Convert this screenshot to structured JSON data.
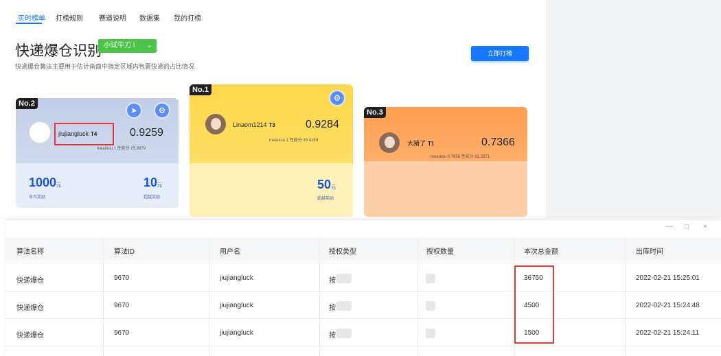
{
  "nav": {
    "tabs": [
      "实时榜单",
      "打榜规则",
      "赛道说明",
      "数据集",
      "我的打榜"
    ],
    "active_index": 0
  },
  "header": {
    "title": "快递爆仓识别",
    "level_tag": "小试牛刀 I",
    "subtitle": "快递爆仓算法主要用于估计画面中指定区域内包裹快递的占比情况",
    "join_button": "立即打榜"
  },
  "podium": {
    "second": {
      "rank": "No.2",
      "user": "jiujiangluck",
      "tier": "T4",
      "score": "0.9259",
      "meta": "meaniou 1   性能分 25.9879",
      "rewards": [
        {
          "amount": "1000",
          "unit": "元",
          "label": "早鸟奖励"
        },
        {
          "amount": "10",
          "unit": "元",
          "label": "超越奖励"
        }
      ]
    },
    "first": {
      "rank": "No.1",
      "user": "Linaom1214",
      "tier": "T3",
      "score": "0.9284",
      "meta": "meaniou 1   性能分 28.4169",
      "rewards": [
        {
          "amount": "50",
          "unit": "元",
          "label": "超越奖励"
        }
      ]
    },
    "third": {
      "rank": "No.3",
      "user": "大猪了",
      "tier": "T1",
      "score": "0.7366",
      "meta": "meaniou 0.7836   性能分 31.3871"
    }
  },
  "table": {
    "window_controls": [
      "—",
      "□",
      "×"
    ],
    "columns": [
      "算法名称",
      "算法ID",
      "用户名",
      "授权类型",
      "授权数量",
      "本次总金额",
      "出库时间"
    ],
    "rows": [
      {
        "algo": "快递爆仓",
        "id": "9670",
        "user": "jiujiangluck",
        "type": "按",
        "amount": "36750",
        "time": "2022-02-21 15:25:01"
      },
      {
        "algo": "快递爆仓",
        "id": "9670",
        "user": "jiujiangluck",
        "type": "按",
        "amount": "4500",
        "time": "2022-02-21 15:24:48"
      },
      {
        "algo": "快递爆仓",
        "id": "9670",
        "user": "jiujiangluck",
        "type": "按",
        "amount": "1500",
        "time": "2022-02-21 15:24:11"
      }
    ]
  },
  "colors": {
    "accent": "#1677ff",
    "highlight": "#e53935",
    "level_tag": "#4cc44a"
  }
}
